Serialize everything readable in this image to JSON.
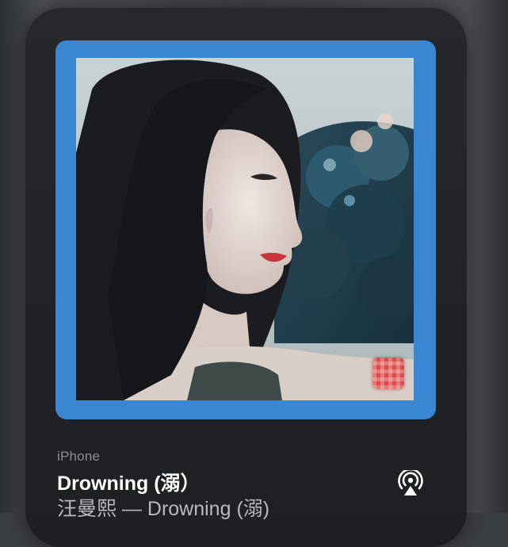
{
  "now_playing": {
    "source": "iPhone",
    "track_title": "Drowning (溺）",
    "artist_album": "汪曼熙 — Drowning (溺)"
  },
  "icons": {
    "airplay": "airplay-audio-icon",
    "badge": "app-badge-icon"
  },
  "colors": {
    "artwork_border": "#3a86d3",
    "badge": "#e24a4a",
    "card_bg": "#222428",
    "title_text": "#ffffff",
    "secondary_text": "#8a8d93"
  }
}
